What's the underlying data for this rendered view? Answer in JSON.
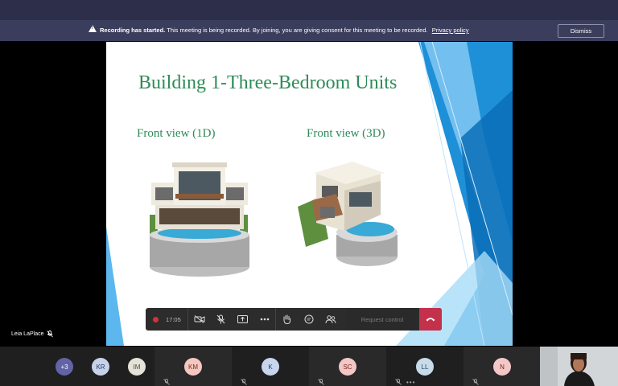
{
  "banner": {
    "bold": "Recording has started.",
    "text": "This meeting is being recorded. By joining, you are giving consent for this meeting to be recorded.",
    "link": "Privacy policy",
    "dismiss": "Dismiss"
  },
  "slide": {
    "title": "Building 1-Three-Bedroom Units",
    "subtitle_left": "Front view (1D)",
    "subtitle_right": "Front view (3D)"
  },
  "presenter": {
    "name": "Leia LaPlace"
  },
  "controls": {
    "timer": "17:05",
    "request_control": "Request control"
  },
  "participants": [
    {
      "initials": "+3",
      "bg": "#6264a7",
      "fg": "#ffffff"
    },
    {
      "initials": "KR",
      "bg": "#c7d2ea",
      "fg": "#2b3a67"
    },
    {
      "initials": "IM",
      "bg": "#e3e3d9",
      "fg": "#4a4a3a"
    },
    {
      "initials": "KM",
      "bg": "#f4c7c0",
      "fg": "#7a2b20"
    },
    {
      "initials": "K",
      "bg": "#c7d6ee",
      "fg": "#2b3a67"
    },
    {
      "initials": "SC",
      "bg": "#f4c7c7",
      "fg": "#7a2020"
    },
    {
      "initials": "LL",
      "bg": "#c7dbe8",
      "fg": "#1f4a6a"
    },
    {
      "initials": "N",
      "bg": "#f4c7c7",
      "fg": "#7a2020"
    }
  ],
  "colors": {
    "title_green": "#2e8b57",
    "hangup_red": "#c4314b",
    "record_red": "#d13438",
    "slide_blue": "#4aa8e8"
  }
}
